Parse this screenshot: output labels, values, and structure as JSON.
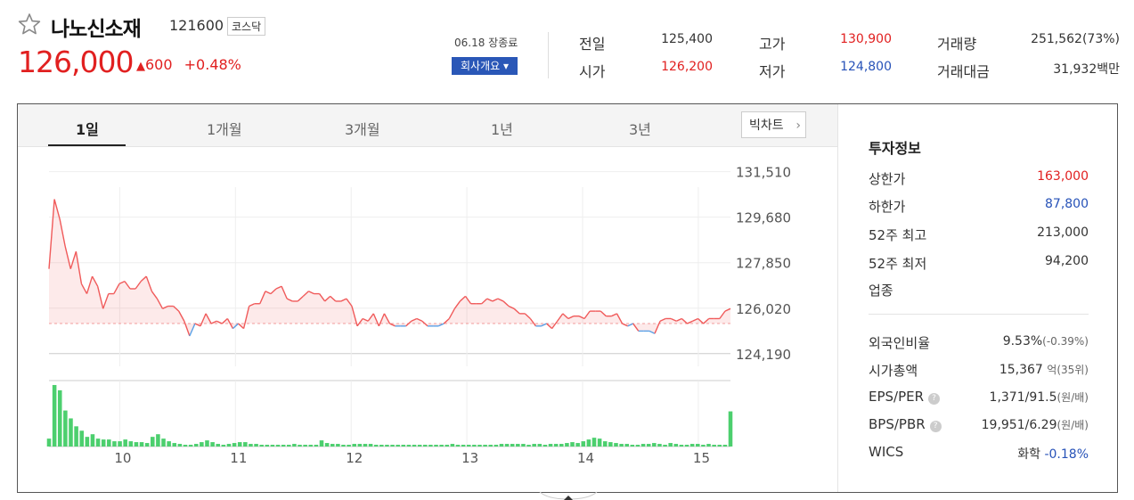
{
  "stock": {
    "name": "나노신소재",
    "code": "121600",
    "market": "코스닥",
    "price": "126,000",
    "change_arrow": "▲",
    "change": "600",
    "change_pct": "+0.48%",
    "date_status": "06.18 장종료",
    "company_button": "회사개요 ▾"
  },
  "summary": {
    "prev_close": {
      "label": "전일",
      "value": "125,400"
    },
    "open": {
      "label": "시가",
      "value": "126,200"
    },
    "high": {
      "label": "고가",
      "value": "130,900"
    },
    "low": {
      "label": "저가",
      "value": "124,800"
    },
    "volume": {
      "label": "거래량",
      "value": "251,562(73%)"
    },
    "amount": {
      "label": "거래대금",
      "value": "31,932백만"
    }
  },
  "tabs": [
    "1일",
    "1개월",
    "3개월",
    "1년",
    "3년"
  ],
  "active_tab": "1일",
  "big_chart_label": "빅차트",
  "colors": {
    "up": "#e12020",
    "down": "#2752b8",
    "volume": "#4ccf6e",
    "line_up": "#f05a5a",
    "line_down": "#5aa0e6"
  },
  "investment": {
    "title": "투자정보",
    "upper_limit": {
      "label": "상한가",
      "value": "163,000"
    },
    "lower_limit": {
      "label": "하한가",
      "value": "87,800"
    },
    "high_52w": {
      "label": "52주 최고",
      "value": "213,000"
    },
    "low_52w": {
      "label": "52주 최저",
      "value": "94,200"
    },
    "sector": {
      "label": "업종",
      "value": ""
    },
    "foreign_ratio": {
      "label": "외국인비율",
      "value": "9.53%",
      "sub": "(-0.39%)"
    },
    "market_cap": {
      "label": "시가총액",
      "value": "15,367",
      "unit": "억",
      "sub": "(35위)"
    },
    "eps_per": {
      "label": "EPS/PER",
      "value": "1,371/91.5",
      "unit": "(원/배)"
    },
    "bps_pbr": {
      "label": "BPS/PBR",
      "value": "19,951/6.29",
      "unit": "(원/배)"
    },
    "wics": {
      "label": "WICS",
      "value": "화학",
      "sub": "-0.18%"
    }
  },
  "chart_data": {
    "type": "line",
    "ylim": [
      123000,
      132500
    ],
    "y_ticks": [
      131510,
      129680,
      127850,
      126020,
      124190
    ],
    "y_tick_labels": [
      "131,510",
      "129,680",
      "127,850",
      "126,020",
      "124,190"
    ],
    "x_tick_labels": [
      "10",
      "11",
      "12",
      "13",
      "14",
      "15"
    ],
    "x_tick_index": [
      11,
      29,
      47,
      65,
      83,
      101
    ],
    "baseline": 125400,
    "prices": [
      127600,
      130400,
      129600,
      128500,
      127600,
      128300,
      127000,
      126600,
      127300,
      126900,
      126000,
      126600,
      126600,
      127000,
      127100,
      126800,
      126800,
      127100,
      127300,
      126700,
      126400,
      126000,
      126100,
      126100,
      125900,
      125500,
      124900,
      125400,
      125300,
      125800,
      125400,
      125500,
      125400,
      125600,
      125200,
      125400,
      125200,
      126100,
      126200,
      126200,
      126700,
      126600,
      126800,
      126900,
      126400,
      126300,
      126300,
      126500,
      126700,
      126600,
      126600,
      126300,
      126500,
      126300,
      126300,
      126400,
      126100,
      125300,
      125600,
      125500,
      125800,
      125300,
      125800,
      125400,
      125300,
      125300,
      125300,
      125500,
      125600,
      125500,
      125300,
      125300,
      125300,
      125400,
      125600,
      126000,
      126300,
      126500,
      126200,
      126200,
      126200,
      126400,
      126300,
      126400,
      126300,
      126100,
      126000,
      125800,
      125800,
      125600,
      125300,
      125300,
      125400,
      125200,
      125500,
      125800,
      125600,
      125700,
      125700,
      125600,
      125900,
      125900,
      125900,
      125700,
      125700,
      125800,
      125400,
      125300,
      125400,
      125100,
      125100,
      125100,
      125000,
      125500,
      125600,
      125600,
      125500,
      125600,
      125400,
      125500,
      125600,
      125400,
      125600,
      125600,
      125600,
      125900,
      126000
    ],
    "volumes": [
      9,
      70,
      64,
      41,
      32,
      23,
      18,
      11,
      14,
      9,
      8,
      8,
      6,
      6,
      8,
      6,
      5,
      5,
      4,
      11,
      14,
      9,
      6,
      4,
      3,
      2,
      2,
      3,
      5,
      7,
      5,
      3,
      2,
      3,
      4,
      5,
      5,
      3,
      3,
      2,
      2,
      2,
      2,
      2,
      2,
      3,
      2,
      2,
      2,
      2,
      7,
      4,
      3,
      3,
      2,
      2,
      3,
      3,
      3,
      3,
      2,
      2,
      2,
      2,
      2,
      2,
      2,
      2,
      2,
      2,
      2,
      2,
      2,
      2,
      3,
      2,
      2,
      2,
      2,
      2,
      2,
      2,
      2,
      3,
      3,
      3,
      3,
      3,
      2,
      3,
      3,
      2,
      3,
      3,
      3,
      4,
      5,
      4,
      6,
      8,
      10,
      9,
      6,
      5,
      4,
      3,
      3,
      2,
      2,
      3,
      3,
      4,
      3,
      2,
      4,
      3,
      2,
      2,
      3,
      3,
      2,
      3,
      2,
      2,
      2,
      40
    ]
  }
}
